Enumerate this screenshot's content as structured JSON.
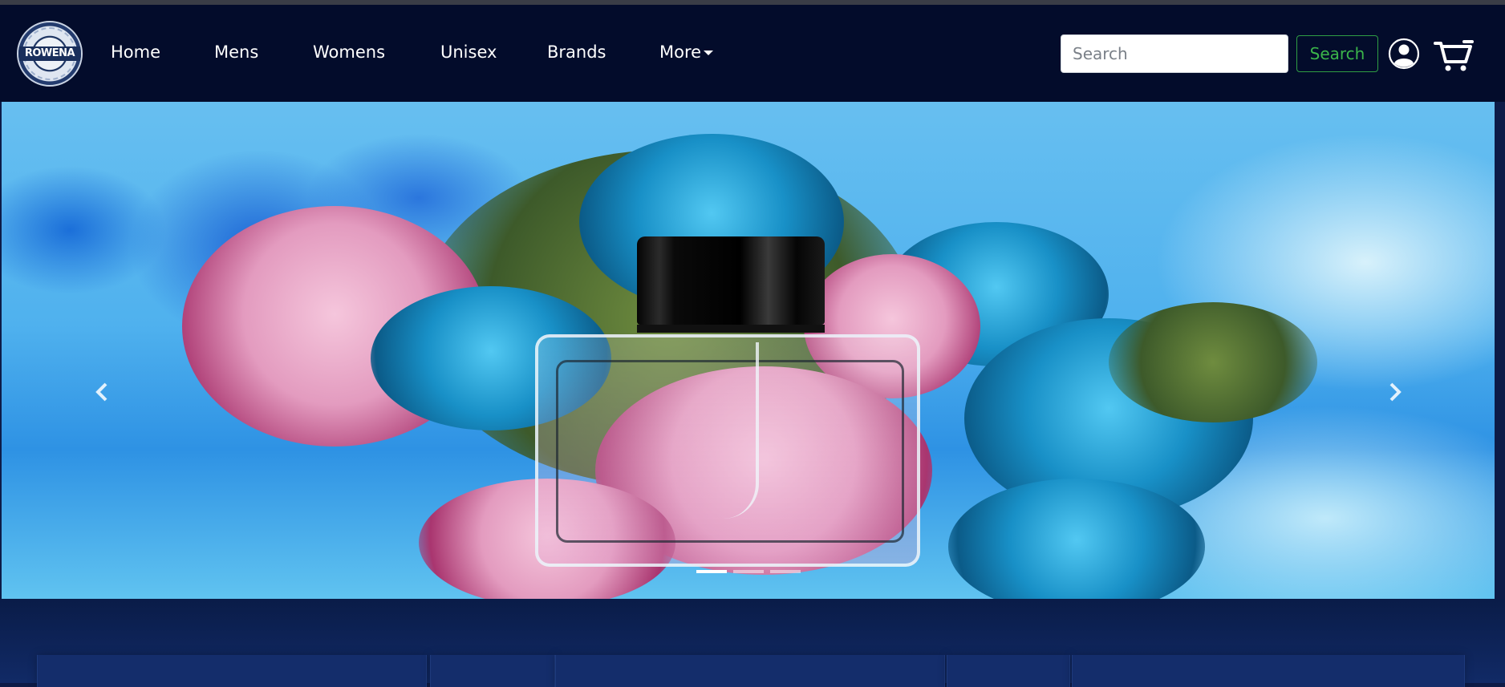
{
  "brand": {
    "logo_text": "ROWENA"
  },
  "nav": {
    "links": [
      {
        "label": "Home"
      },
      {
        "label": "Mens"
      },
      {
        "label": "Womens"
      },
      {
        "label": "Unisex"
      },
      {
        "label": "Brands"
      },
      {
        "label": "More"
      }
    ]
  },
  "search": {
    "placeholder": "Search",
    "value": "",
    "button_label": "Search"
  },
  "icons": {
    "account": "user-circle-icon",
    "cart": "shopping-cart-icon",
    "prev": "chevron-left-icon",
    "next": "chevron-right-icon",
    "dropdown": "caret-down-icon"
  },
  "carousel": {
    "slide_count": 3,
    "active_index": 0
  },
  "colors": {
    "navbar_bg": "#030c2b",
    "page_bg": "#0d1b47",
    "search_button_accent": "#3bb54a"
  }
}
